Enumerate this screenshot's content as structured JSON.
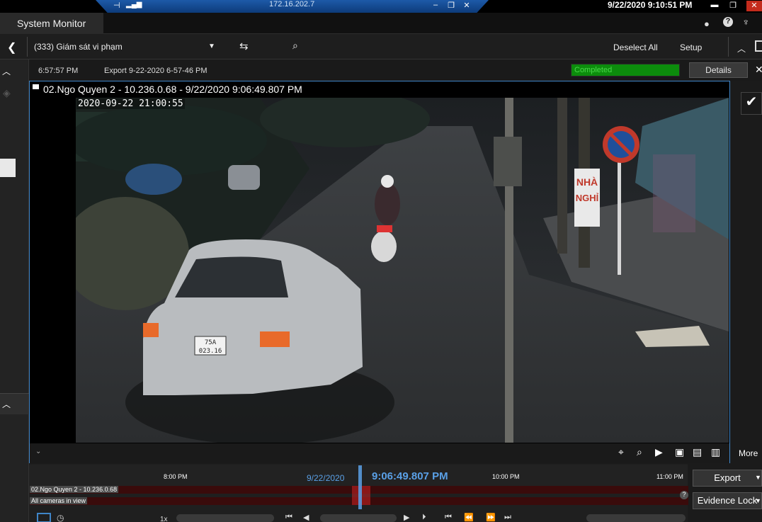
{
  "titlebar": {
    "remote_ip": "172.16.202.7",
    "clock": "9/22/2020 9:10:51 PM"
  },
  "tabs": {
    "system_monitor": "System Monitor"
  },
  "toolbar": {
    "view_name": "(333) Giám sát vi phạm",
    "deselect_all": "Deselect All",
    "setup": "Setup"
  },
  "export_row": {
    "time": "6:57:57 PM",
    "name": "Export 9-22-2020 6-57-46 PM",
    "status": "Completed",
    "progress": 1.0,
    "details": "Details"
  },
  "tile": {
    "title": "02.Ngo Quyen 2 - 10.236.0.68 - 9/22/2020 9:06:49.807 PM",
    "osd_timestamp": "2020-09-22 21:00:55",
    "sign_line1": "NHÀ",
    "sign_line2": "NGHỈ",
    "plate_line1": "75A",
    "plate_line2": "023.16",
    "more": "More"
  },
  "timeline": {
    "ticks": [
      "8:00 PM",
      "10:00 PM",
      "11:00 PM"
    ],
    "date": "9/22/2020",
    "time": "9:06:49.807 PM",
    "track1": "02.Ngo Quyen 2 - 10.236.0.68",
    "track2": "All cameras in view",
    "speed": "1x",
    "help": "?"
  },
  "right_panel": {
    "export": "Export",
    "evidence_lock": "Evidence Lock"
  },
  "colors": {
    "accent": "#3f85c8",
    "timeline_text": "#5aa0e6",
    "progress": "#0a7a0a",
    "track": "#3a0b0b"
  }
}
